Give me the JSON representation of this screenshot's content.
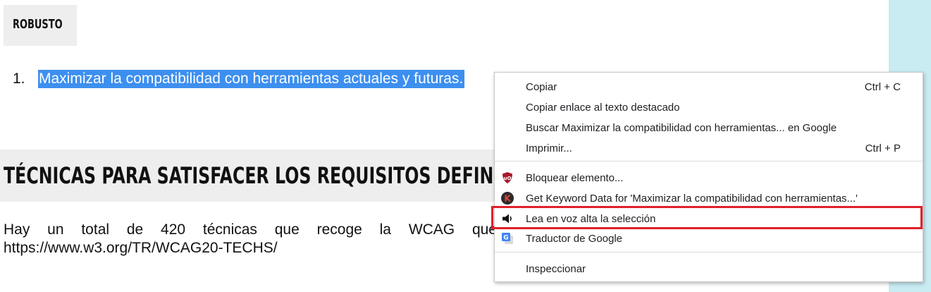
{
  "page": {
    "section_tag": "ROBUSTO",
    "list_number": "1.",
    "list_item": "Maximizar la compatibilidad con herramientas actuales y futuras.",
    "heading": "TÉCNICAS PARA SATISFACER LOS REQUISITOS DEFINIDOS E",
    "paragraph_line1_words": [
      "Hay",
      "un",
      "total",
      "de",
      "420",
      "técnicas",
      "que",
      "recoge",
      "la",
      "WCAG",
      "que"
    ],
    "paragraph_line2": "https://www.w3.org/TR/WCAG20-TECHS/"
  },
  "context_menu": {
    "copy": {
      "label": "Copiar",
      "shortcut": "Ctrl + C"
    },
    "copy_link": {
      "label": "Copiar enlace al texto destacado"
    },
    "search_google": {
      "label": "Buscar Maximizar la compatibilidad con herramientas... en Google"
    },
    "print": {
      "label": "Imprimir...",
      "shortcut": "Ctrl + P"
    },
    "block_element": {
      "label": "Bloquear elemento...",
      "icon": "ublock-origin-icon"
    },
    "keyword_data": {
      "label": "Get Keyword Data for 'Maximizar la compatibilidad con herramientas...'",
      "icon": "keywords-k-icon",
      "icon_letter": "K"
    },
    "read_aloud": {
      "label": "Lea en voz alta la selección",
      "icon": "speaker-icon"
    },
    "translate": {
      "label": "Traductor de Google",
      "icon": "google-translate-icon"
    },
    "inspect": {
      "label": "Inspeccionar"
    }
  },
  "colors": {
    "selection": "#3d8fef",
    "highlight_box": "#e0202a",
    "right_strip": "#c9ebf2",
    "ublock_red": "#a8182b",
    "keywords_k": "#e0443c",
    "translate_blue": "#4285f4"
  }
}
